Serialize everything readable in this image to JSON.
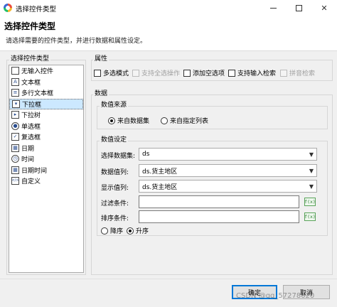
{
  "window": {
    "title": "选择控件类型"
  },
  "header": {
    "title": "选择控件类型",
    "subtitle": "请选择需要的控件类型，并进行数据和属性设定。"
  },
  "control_types": {
    "label": "选择控件类型",
    "items": [
      {
        "label": "无输入控件",
        "icon": "empty-box-icon",
        "glyph": ""
      },
      {
        "label": "文本框",
        "icon": "textbox-icon",
        "glyph": "A"
      },
      {
        "label": "多行文本框",
        "icon": "multiline-textbox-icon",
        "glyph": "≡"
      },
      {
        "label": "下拉框",
        "icon": "dropdown-icon",
        "glyph": "▾",
        "selected": true
      },
      {
        "label": "下拉树",
        "icon": "dropdown-tree-icon",
        "glyph": "▸"
      },
      {
        "label": "单选框",
        "icon": "radio-icon",
        "glyph": "●"
      },
      {
        "label": "复选框",
        "icon": "checkbox-icon",
        "glyph": "✓"
      },
      {
        "label": "日期",
        "icon": "calendar-icon",
        "glyph": "▦"
      },
      {
        "label": "时间",
        "icon": "clock-icon",
        "glyph": "◷"
      },
      {
        "label": "日期时间",
        "icon": "datetime-icon",
        "glyph": "▦"
      },
      {
        "label": "自定义",
        "icon": "custom-code-icon",
        "glyph": "</>"
      }
    ]
  },
  "properties": {
    "label": "属性",
    "multi_select": "多选模式",
    "select_all": "支持全选操作",
    "add_empty": "添加空选项",
    "input_search": "支持输入检索",
    "pinyin_search": "拼音检索"
  },
  "data": {
    "label": "数据",
    "source": {
      "label": "数值来源",
      "from_dataset": "来自数据集",
      "from_list": "来自指定列表"
    },
    "settings": {
      "label": "数值设定",
      "dataset_label": "选择数据集:",
      "dataset_value": "ds",
      "value_col_label": "数据值列:",
      "value_col_value": "ds.货主地区",
      "display_col_label": "显示值列:",
      "display_col_value": "ds.货主地区",
      "filter_label": "过滤条件:",
      "sort_label": "排序条件:",
      "fx": "f(x)",
      "desc": "降序",
      "asc": "升序"
    }
  },
  "footer": {
    "ok": "确定",
    "cancel": "取消",
    "watermark": "CSDN @qq_57278020"
  }
}
